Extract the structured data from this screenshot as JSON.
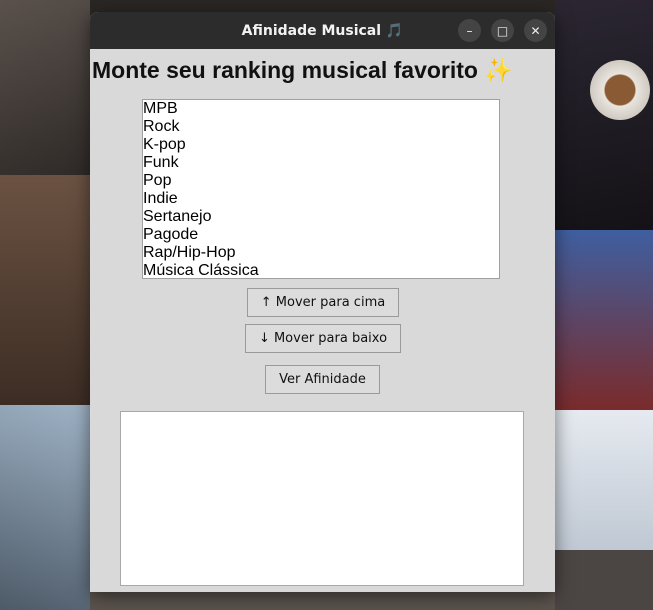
{
  "window": {
    "title": "Afinidade Musical 🎵",
    "controls": {
      "minimize": "–",
      "maximize": "□",
      "close": "✕"
    }
  },
  "heading": "Monte seu ranking musical favorito ✨",
  "genres": [
    "MPB",
    "Rock",
    "K-pop",
    "Funk",
    "Pop",
    "Indie",
    "Sertanejo",
    "Pagode",
    "Rap/Hip-Hop",
    "Música Clássica"
  ],
  "buttons": {
    "move_up": "↑ Mover para cima",
    "move_down": "↓ Mover para baixo",
    "show_affinity": "Ver Afinidade"
  },
  "result_text": ""
}
